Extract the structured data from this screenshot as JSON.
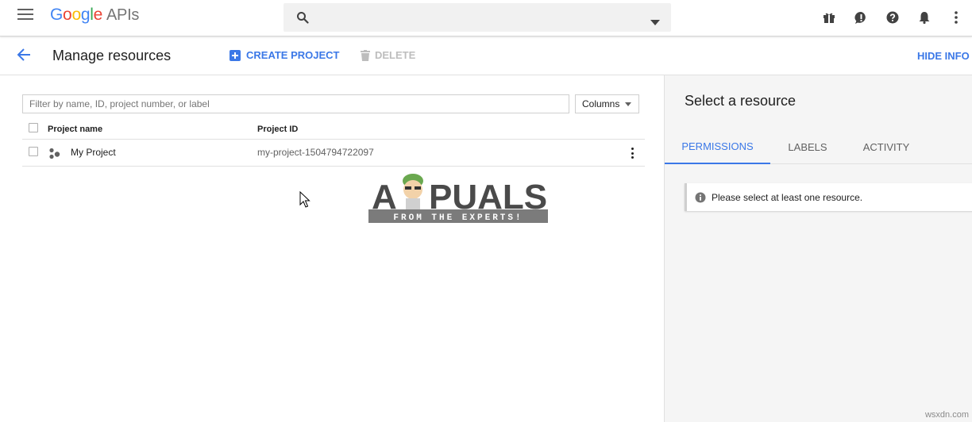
{
  "app": {
    "logo_google_letters": [
      "G",
      "o",
      "o",
      "g",
      "l",
      "e"
    ],
    "logo_suffix": "APIs",
    "colors": {
      "blue": "#4285f4",
      "red": "#ea4335",
      "yellow": "#fbbc05",
      "green": "#34a853",
      "accent": "#3b78e7"
    }
  },
  "topbar": {
    "menu_icon": "hamburger-menu-icon",
    "search_icon": "search-icon",
    "search_value": "",
    "search_dropdown_icon": "caret-down-icon",
    "icons": [
      "gift-icon",
      "feedback-icon",
      "help-icon",
      "notifications-icon",
      "more-vert-icon"
    ]
  },
  "header": {
    "back_icon": "arrow-back-icon",
    "title": "Manage resources",
    "create_label": "CREATE PROJECT",
    "delete_label": "DELETE",
    "hide_info_label": "HIDE INFO P"
  },
  "filter": {
    "placeholder": "Filter by name, ID, project number, or label",
    "value": ""
  },
  "columns_button": "Columns",
  "table": {
    "headers": [
      "Project name",
      "Project ID"
    ],
    "rows": [
      {
        "name": "My Project",
        "id": "my-project-1504794722097",
        "icon": "project-icon"
      }
    ]
  },
  "info_panel": {
    "title": "Select a resource",
    "tabs": [
      {
        "label": "PERMISSIONS",
        "active": true
      },
      {
        "label": "LABELS",
        "active": false
      },
      {
        "label": "ACTIVITY",
        "active": false
      }
    ],
    "notice": "Please select at least one resource.",
    "notice_icon": "info-icon"
  },
  "watermark": {
    "brand": "APPUALS",
    "text_left": "A",
    "text_right": "PUALS",
    "tagline": "FROM THE EXPERTS!"
  },
  "footer_watermark": "wsxdn.com"
}
